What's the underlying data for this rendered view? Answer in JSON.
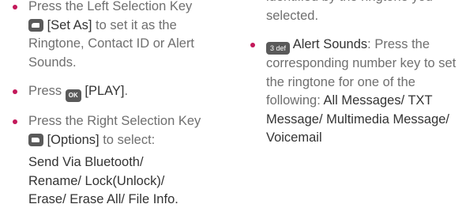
{
  "left": {
    "item1": {
      "text_a": "Press the Left Selection Key",
      "key_label": "[Set As]",
      "text_b": " to set it as the Ringtone, Contact ID or Alert Sounds."
    },
    "item2": {
      "text_a": "Press ",
      "key_icon": "OK",
      "key_label": "[PLAY]",
      "text_b": "."
    },
    "item3": {
      "text_a": "Press the Right Selection Key",
      "key_label": "[Options]",
      "text_b": " to select:",
      "options_lines": [
        "Send Via Bluetooth/",
        "Rename/ Lock(Unlock)/",
        "Erase/ Erase All/ File Info."
      ]
    }
  },
  "right": {
    "continued_text": "identified by the ringtone you selected.",
    "item1": {
      "key_icon": "3 def",
      "label": "Alert Sounds",
      "text_a": ": Press the corresponding number key to set the ringtone for one of the following: ",
      "options": "All Messages/ TXT Message/ Multimedia Message/ Voicemail"
    }
  },
  "colors": {
    "bullet": "#c3185a",
    "body_text": "#6f6f6f",
    "emphasis_text": "#333333",
    "key_background": "#5a5a5a"
  }
}
